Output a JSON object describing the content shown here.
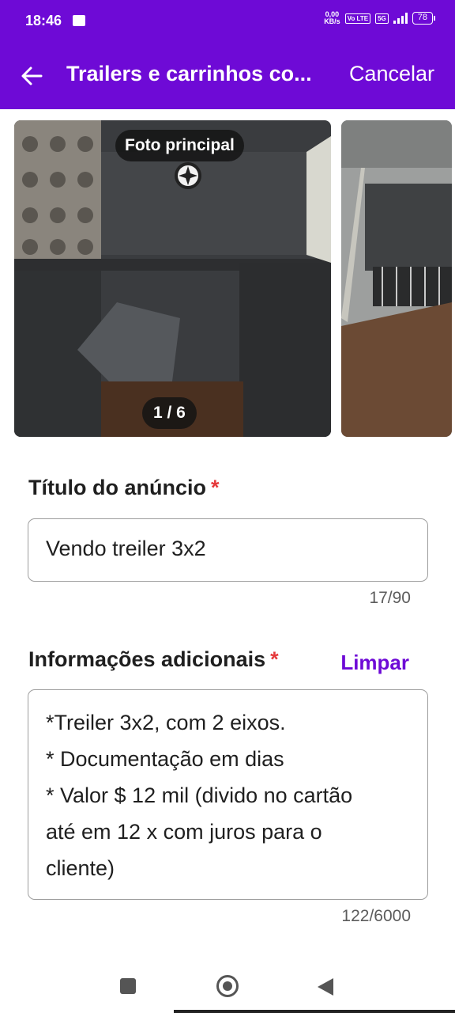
{
  "status_bar": {
    "time": "18:46",
    "net_speed_value": "0,00",
    "net_speed_unit": "KB/s",
    "chip_volte": "Vo LTE",
    "chip_5g": "5G",
    "battery": "78"
  },
  "app_bar": {
    "title": "Trailers e carrinhos co...",
    "cancel_label": "Cancelar",
    "back_icon": "arrow-left-icon"
  },
  "gallery": {
    "main_badge": "Foto principal",
    "counter": "1 / 6"
  },
  "title_field": {
    "label": "Título do anúncio",
    "required_mark": "*",
    "value": "Vendo treiler 3x2",
    "counter": "17/90"
  },
  "description_field": {
    "label": "Informações adicionais",
    "required_mark": "*",
    "clear_label": "Limpar",
    "lines": [
      "*Treiler 3x2, com 2 eixos.",
      "* Documentação em dias",
      "* Valor $ 12 mil (divido no cartão",
      "até em 12 x com juros para o",
      "cliente)"
    ],
    "counter": "122/6000"
  },
  "colors": {
    "brand": "#6e0ad6",
    "required": "#e5393b"
  }
}
